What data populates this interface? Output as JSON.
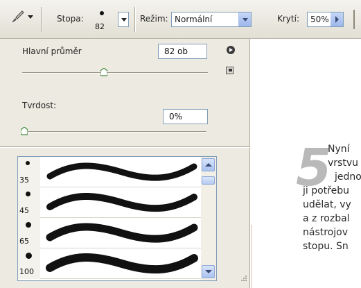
{
  "options_bar": {
    "tool_icon": "brush-icon",
    "stopa_label": "Stopa:",
    "stopa_size": "82",
    "rezim_label": "Režim:",
    "rezim_value": "Normální",
    "kryti_label": "Krytí:",
    "kryti_value": "50%"
  },
  "brush_panel": {
    "diameter_label": "Hlavní průměr",
    "diameter_value": "82 ob",
    "diameter_slider": 0.44,
    "hardness_label": "Tvrdost:",
    "hardness_value": "0%",
    "hardness_slider": 0.0,
    "presets": [
      {
        "size": "35",
        "dot": 6
      },
      {
        "size": "45",
        "dot": 7
      },
      {
        "size": "65",
        "dot": 8
      },
      {
        "size": "100",
        "dot": 9
      }
    ]
  },
  "document": {
    "step_number": "5",
    "lines": [
      "Nyní",
      "vrstvu",
      "jedno",
      "ji potřebu",
      "udělat, vy",
      "a z rozbal",
      "nástrojov",
      "stopu. Sn"
    ]
  }
}
